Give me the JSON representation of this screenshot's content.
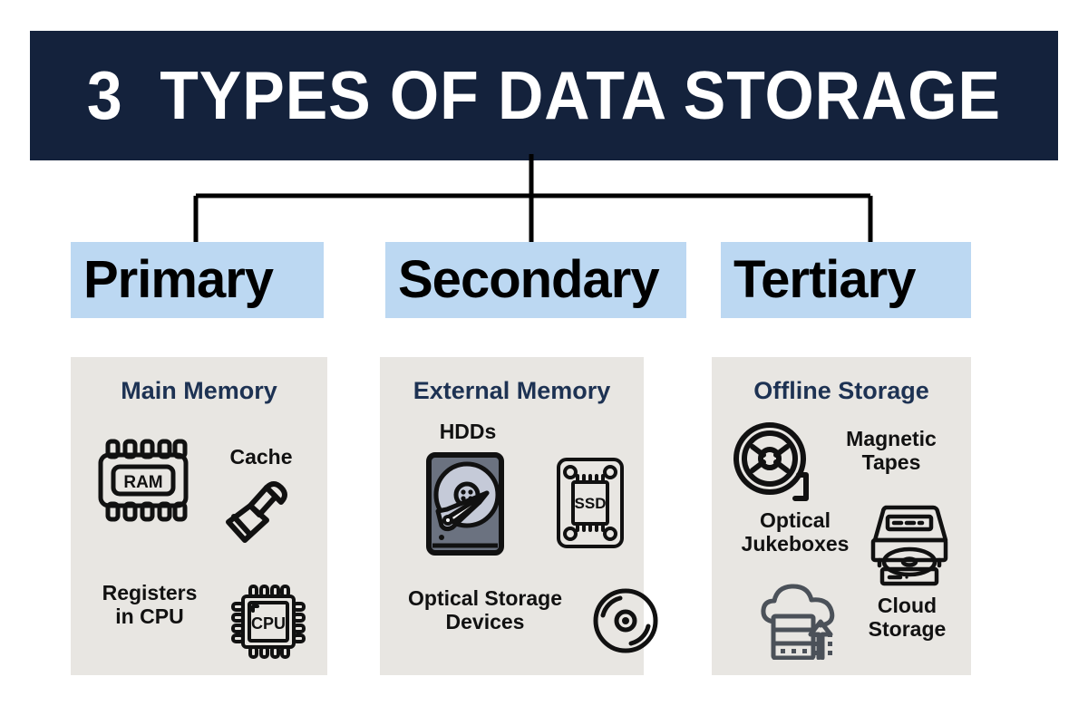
{
  "title": {
    "text": "3  TYPES OF DATA STORAGE",
    "background_color": "#14223c",
    "text_color": "#ffffff"
  },
  "theme": {
    "page_background": "#ffffff",
    "band_color": "#bcd8f2",
    "panel_color": "#e8e6e2",
    "heading_color": "#1d3253",
    "icon_stroke": "#111111",
    "hdd_body_color": "#6b7280",
    "hdd_platter_color": "#c5cad8",
    "cloud_icon_color": "#4b5159",
    "connector_color": "#000000"
  },
  "categories": [
    {
      "name": "Primary",
      "panel_heading": "Main Memory",
      "items": [
        {
          "label": "RAM",
          "icon": "ram-chip-icon"
        },
        {
          "label": "Cache",
          "icon": "brush-icon"
        },
        {
          "label": "Registers in CPU",
          "icon": "cpu-chip-icon"
        }
      ]
    },
    {
      "name": "Secondary",
      "panel_heading": "External Memory",
      "items": [
        {
          "label": "HDDs",
          "icon": "hard-disk-drive-icon"
        },
        {
          "label": "SSD",
          "icon": "ssd-icon"
        },
        {
          "label": "Optical Storage Devices",
          "icon": "optical-disc-icon"
        }
      ]
    },
    {
      "name": "Tertiary",
      "panel_heading": "Offline Storage",
      "items": [
        {
          "label": "Magnetic Tapes",
          "icon": "tape-reel-icon"
        },
        {
          "label": "Optical Jukeboxes",
          "icon": "disc-jukebox-icon"
        },
        {
          "label": "Cloud Storage",
          "icon": "cloud-server-icon"
        }
      ]
    }
  ],
  "icon_text": {
    "ram": "RAM",
    "cpu": "CPU",
    "ssd": "SSD"
  },
  "labels": {
    "registers_line1": "Registers",
    "registers_line2": "in CPU",
    "optical_line1": "Optical Storage",
    "optical_line2": "Devices",
    "magnetic_line1": "Magnetic",
    "magnetic_line2": "Tapes",
    "jukebox_line1": "Optical",
    "jukebox_line2": "Jukeboxes",
    "cloud_line1": "Cloud",
    "cloud_line2": "Storage"
  }
}
